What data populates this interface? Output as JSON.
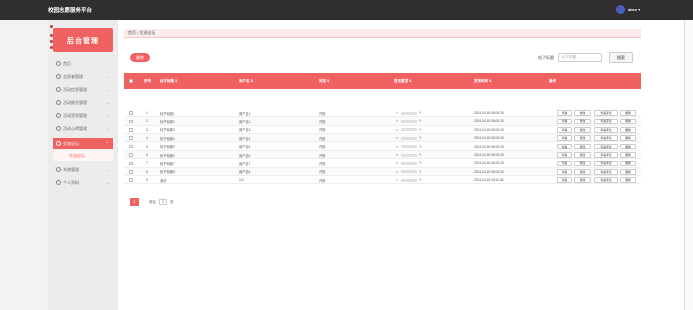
{
  "app": {
    "title": "校园志愿服务平台",
    "user": "abcx"
  },
  "sidebar": {
    "brand": "后台管理",
    "items": [
      {
        "label": "首页",
        "chevron": ""
      },
      {
        "label": "志愿者管理",
        "chevron": "⌄"
      },
      {
        "label": "活动信息管理",
        "chevron": "⌄"
      },
      {
        "label": "活动报名管理",
        "chevron": "⌄"
      },
      {
        "label": "活动签到管理",
        "chevron": "⌄"
      },
      {
        "label": "活动心得管理",
        "chevron": "⌄"
      },
      {
        "label": "交流论坛",
        "chevron": "⌃"
      },
      {
        "label": "系统管理",
        "chevron": "⌄"
      },
      {
        "label": "个人资料",
        "chevron": "⌄"
      }
    ],
    "active_sub": "交流论坛"
  },
  "breadcrumb": "首页 / 交流论坛",
  "toolbar": {
    "delete_label": "删除",
    "search_label": "帖子标题",
    "search_placeholder": "帖子标题",
    "search_button": "搜索"
  },
  "table": {
    "headers": [
      "",
      "序号",
      "帖子标题 ⇅",
      "用户名 ⇅",
      "状态 ⇅",
      "是否置顶 ⇅",
      "发布时间 ⇅",
      "操作"
    ],
    "actions": [
      "查看",
      "修改",
      "查看评论",
      "删除"
    ],
    "rows": [
      {
        "no": "1",
        "title": "帖子标题1",
        "user": "用户名1",
        "status": "开放",
        "time": "2024-04-18 08:00:25"
      },
      {
        "no": "2",
        "title": "帖子标题2",
        "user": "用户名2",
        "status": "开放",
        "time": "2024-04-18 08:00:25"
      },
      {
        "no": "3",
        "title": "帖子标题3",
        "user": "用户名3",
        "status": "开放",
        "time": "2024-04-18 08:00:25"
      },
      {
        "no": "4",
        "title": "帖子标题4",
        "user": "用户名4",
        "status": "开放",
        "time": "2024-04-18 08:00:25"
      },
      {
        "no": "5",
        "title": "帖子标题5",
        "user": "用户名5",
        "status": "开放",
        "time": "2024-04-18 08:00:25"
      },
      {
        "no": "6",
        "title": "帖子标题6",
        "user": "用户名6",
        "status": "开放",
        "time": "2024-04-18 08:00:25"
      },
      {
        "no": "7",
        "title": "帖子标题7",
        "user": "用户名7",
        "status": "开放",
        "time": "2024-04-18 08:00:25"
      },
      {
        "no": "8",
        "title": "帖子标题8",
        "user": "用户名8",
        "status": "开放",
        "time": "2024-04-18 08:00:25"
      },
      {
        "no": "9",
        "title": "测试",
        "user": "111",
        "status": "开放",
        "time": "2024-04-18 08:11:48"
      }
    ]
  },
  "pager": {
    "current": "1",
    "goto_label": "前往",
    "goto_value": "1",
    "page_unit": "页"
  }
}
